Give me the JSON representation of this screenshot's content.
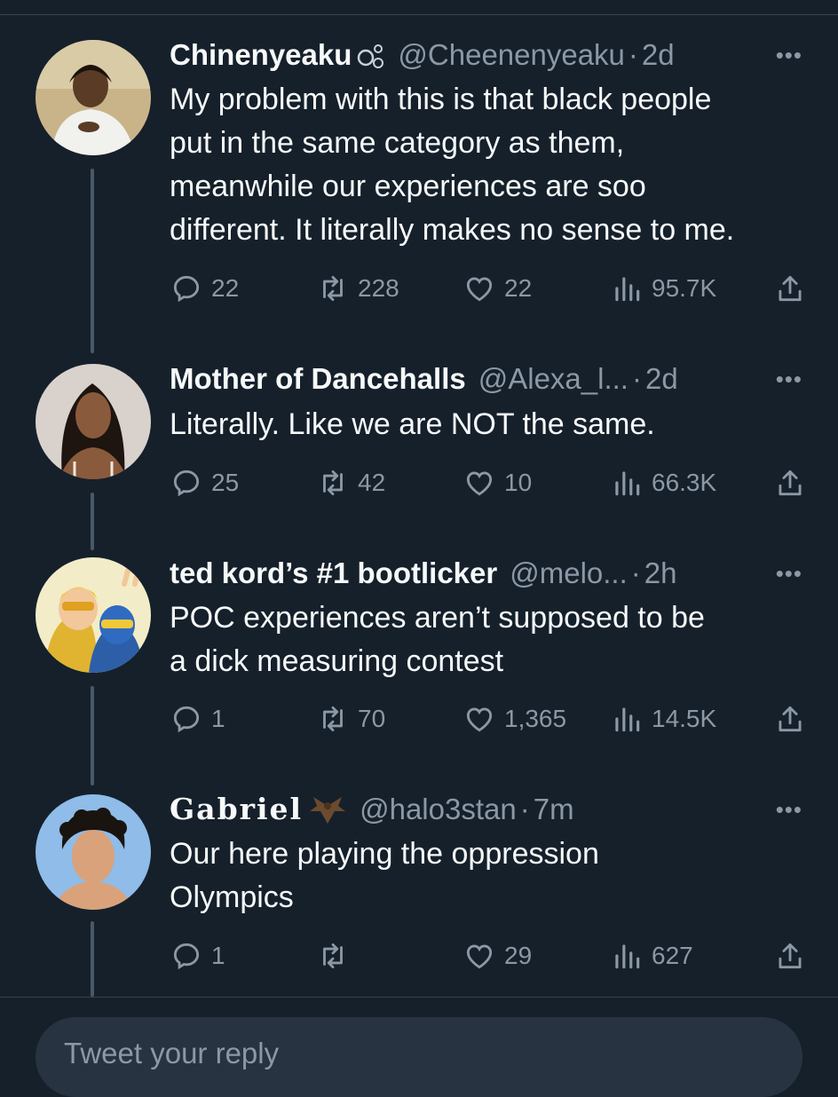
{
  "tweets": [
    {
      "name": "Chinenyeaku",
      "badge_icon": "bubbles-icon",
      "handle": "@Cheenenyeaku",
      "time": "2d",
      "text": "My problem with this is that black people\nput in the same category as them,\nmeanwhile our experiences are soo\ndifferent. It literally makes no sense to me.",
      "replies": "22",
      "retweets": "228",
      "likes": "22",
      "views": "95.7K"
    },
    {
      "name": "Mother of Dancehalls",
      "handle": "@Alexa_l...",
      "time": "2d",
      "text": "Literally. Like we are NOT the same.",
      "replies": "25",
      "retweets": "42",
      "likes": "10",
      "views": "66.3K"
    },
    {
      "name": "ted kord’s #1 bootlicker",
      "handle": "@melo...",
      "time": "2h",
      "text": "POC experiences aren’t supposed to be\na dick measuring contest",
      "replies": "1",
      "retweets": "70",
      "likes": "1,365",
      "views": "14.5K"
    },
    {
      "name": "Gabriel",
      "badge_icon": "bat-icon",
      "handle": "@halo3stan",
      "time": "7m",
      "text": "Our here playing the oppression\nOlympics",
      "replies": "1",
      "retweets": "",
      "likes": "29",
      "views": "627"
    }
  ],
  "separator_dot": "·",
  "more_label": "•••",
  "reply_placeholder": "Tweet your reply",
  "colors": {
    "background": "#15202b",
    "text": "#f7f9f9",
    "secondary": "#8b98a5",
    "thread_line": "#4a5866"
  }
}
